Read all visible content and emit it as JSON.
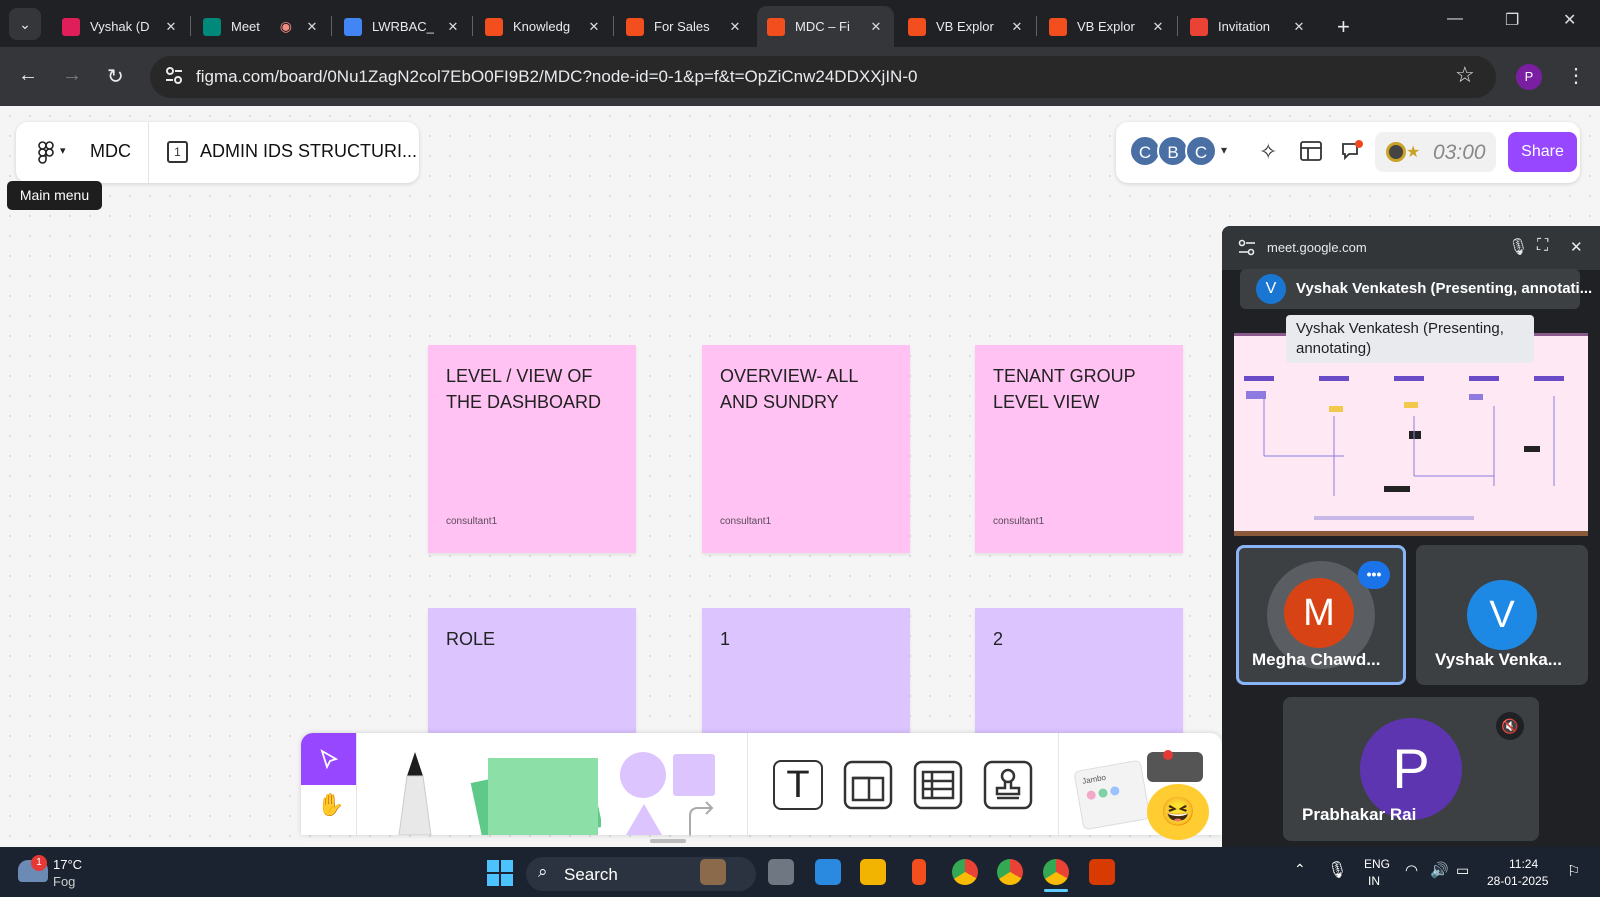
{
  "browser": {
    "tabs": [
      {
        "label": "Vyshak (D",
        "icon_color": "#e01e5a",
        "icon": "slack-icon"
      },
      {
        "label": "Meet",
        "icon_color": "#00897b",
        "icon": "meet-icon",
        "recording": true
      },
      {
        "label": "LWRBAC_",
        "icon_color": "#4285f4",
        "icon": "docs-icon"
      },
      {
        "label": "Knowledg",
        "icon_color": "#f24e1e",
        "icon": "figma-icon"
      },
      {
        "label": "For Sales",
        "icon_color": "#f24e1e",
        "icon": "figma-icon"
      },
      {
        "label": "MDC – Fi",
        "icon_color": "#f24e1e",
        "icon": "figma-icon",
        "active": true
      },
      {
        "label": "VB Explor",
        "icon_color": "#f24e1e",
        "icon": "figma-icon"
      },
      {
        "label": "VB Explor",
        "icon_color": "#f24e1e",
        "icon": "figma-icon"
      },
      {
        "label": "Invitation",
        "icon_color": "#ea4335",
        "icon": "gmail-icon"
      }
    ],
    "url": "figma.com/board/0Nu1ZagN2col7EbO0FI9B2/MDC?node-id=0-1&p=f&t=OpZiCnw24DDXXjIN-0",
    "profile_initial": "P"
  },
  "figma": {
    "file_name": "MDC",
    "page_number": "1",
    "page_name": "ADMIN IDS STRUCTURI...",
    "tooltip": "Main menu",
    "avatars": [
      "C",
      "B",
      "C"
    ],
    "timer": "03:00",
    "share_label": "Share"
  },
  "stickies": [
    {
      "text": "LEVEL / VIEW OF THE DASHBOARD",
      "author": "consultant1",
      "color": "pink"
    },
    {
      "text": "OVERVIEW- ALL AND SUNDRY",
      "author": "consultant1",
      "color": "pink"
    },
    {
      "text": "TENANT GROUP LEVEL VIEW",
      "author": "consultant1",
      "color": "pink"
    },
    {
      "text": "ROLE",
      "color": "lav"
    },
    {
      "text": "1",
      "color": "lav"
    },
    {
      "text": "2",
      "color": "lav"
    }
  ],
  "toolbar": {
    "text_tool": "T",
    "widget_label": "Jambo"
  },
  "meet": {
    "domain": "meet.google.com",
    "presenter_initial": "V",
    "presenter_label": "Vyshak Venkatesh (Presenting, annotati...",
    "tooltip": "Vyshak Venkatesh (Presenting, annotating)",
    "participants": [
      {
        "initial": "M",
        "name": "Megha Chawd...",
        "color": "#d84315"
      },
      {
        "initial": "V",
        "name": "Vyshak Venka...",
        "color": "#1e88e5"
      },
      {
        "initial": "P",
        "name": "Prabhakar Rai",
        "color": "#5e35b1"
      }
    ]
  },
  "taskbar": {
    "notification_count": "1",
    "temperature": "17°C",
    "weather": "Fog",
    "search_label": "Search",
    "lang1": "ENG",
    "lang2": "IN",
    "time": "11:24",
    "date": "28-01-2025"
  }
}
